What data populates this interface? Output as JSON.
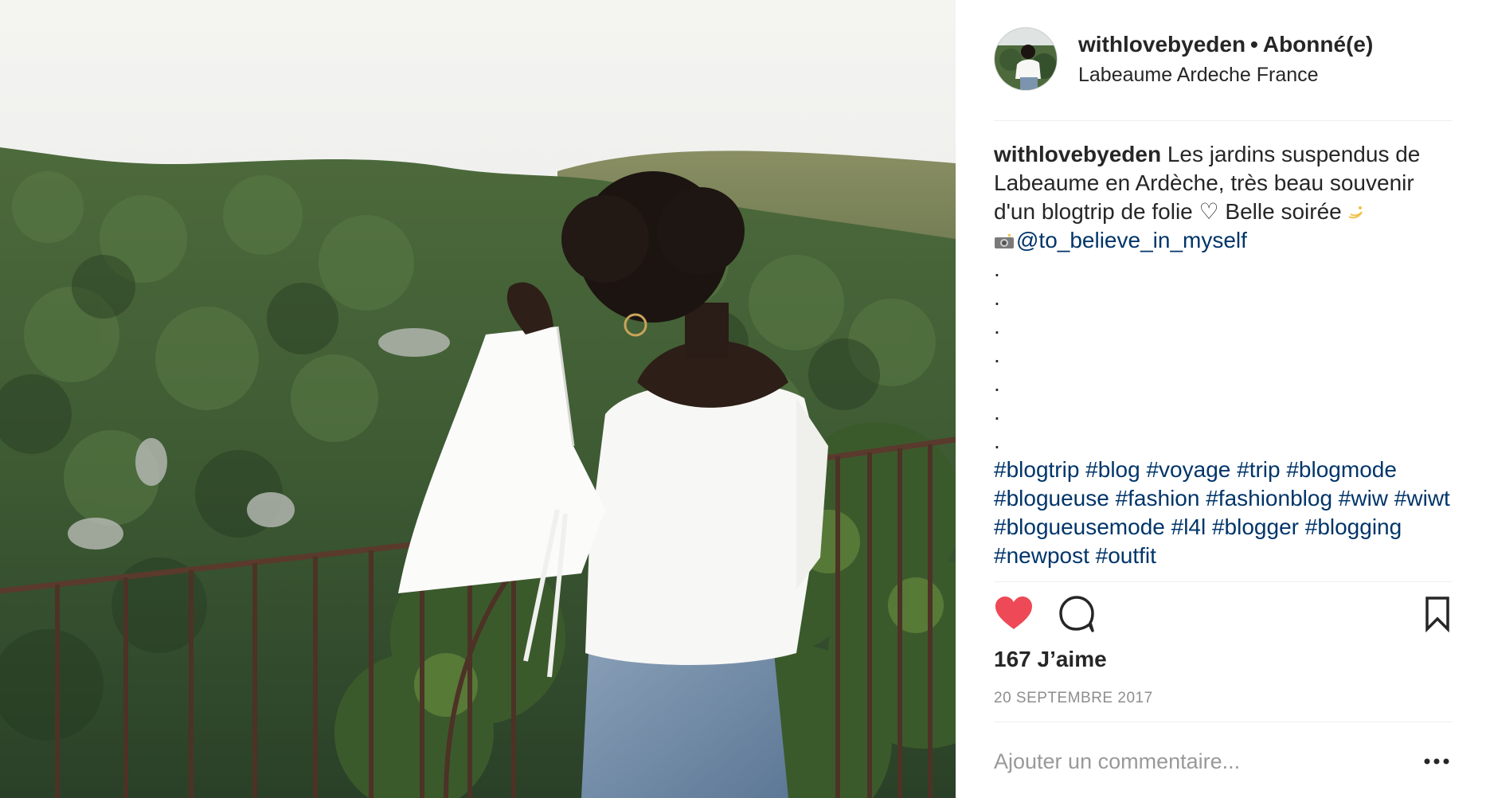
{
  "post": {
    "username": "withlovebyeden",
    "separator": "•",
    "follow_status": "Abonné(e)",
    "location": "Labeaume Ardeche France"
  },
  "caption": {
    "username": "withlovebyeden",
    "text": " Les jardins suspendus de Labeaume en Ardèche, très beau souvenir d'un blogtrip de folie ♡ Belle soirée",
    "mention": "@to_believe_in_myself",
    "dots": [
      ".",
      ".",
      ".",
      ".",
      ".",
      ".",
      "."
    ],
    "hashtags": "#blogtrip #blog #voyage #trip #blogmode #blogueuse #fashion #fashionblog #wiw #wiwt #bloguеusemode #l4l #blogger #blogging #newpost #outfit"
  },
  "actions": {
    "like_icon": "heart-icon",
    "comment_icon": "comment-bubble-icon",
    "save_icon": "bookmark-icon",
    "like_color": "#ed4956"
  },
  "likes_text": "167 J’aime",
  "date_text": "20 SEPTEMBRE 2017",
  "comment": {
    "placeholder": "Ajouter un commentaire...",
    "more_icon": "more-options-icon"
  }
}
